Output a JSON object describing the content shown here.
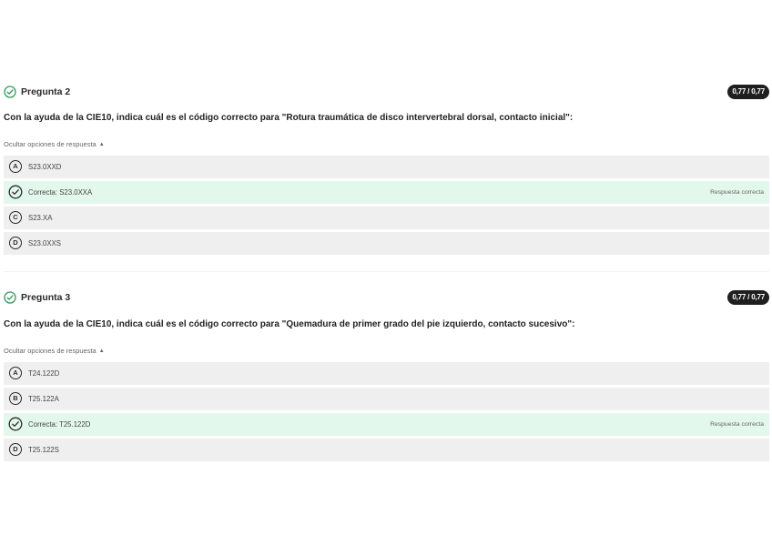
{
  "questions": [
    {
      "title": "Pregunta 2",
      "score": "0,77 / 0,77",
      "text": "Con la ayuda de la CIE10, indica cuál es el código correcto para \"Rotura traumática de disco intervertebral dorsal, contacto inicial\":",
      "toggle_label": "Ocultar opciones de respuesta",
      "options": [
        {
          "letter": "A",
          "label": "S23.0XXD"
        },
        {
          "letter": "",
          "label": "Correcta: S23.0XXA",
          "feedback": "Respuesta correcta"
        },
        {
          "letter": "C",
          "label": "S23.XA"
        },
        {
          "letter": "D",
          "label": "S23.0XXS"
        }
      ]
    },
    {
      "title": "Pregunta 3",
      "score": "0,77 / 0,77",
      "text": "Con la ayuda de la CIE10, indica cuál es el código correcto para \"Quemadura de primer grado del pie izquierdo, contacto sucesivo\":",
      "toggle_label": "Ocultar opciones de respuesta",
      "options": [
        {
          "letter": "A",
          "label": "T24.122D"
        },
        {
          "letter": "B",
          "label": "T25.122A"
        },
        {
          "letter": "",
          "label": "Correcta: T25.122D",
          "feedback": "Respuesta correcta"
        },
        {
          "letter": "D",
          "label": "T25.122S"
        }
      ]
    }
  ],
  "icons": {
    "status": "check-circle-icon",
    "correct_option": "check-circle-icon",
    "toggle": "chevron-up-icon"
  },
  "colors": {
    "correct_background": "#e3f8ec",
    "option_background": "#efefef",
    "status_check": "#2e9a5b",
    "score_badge": "#1f1f1f"
  }
}
